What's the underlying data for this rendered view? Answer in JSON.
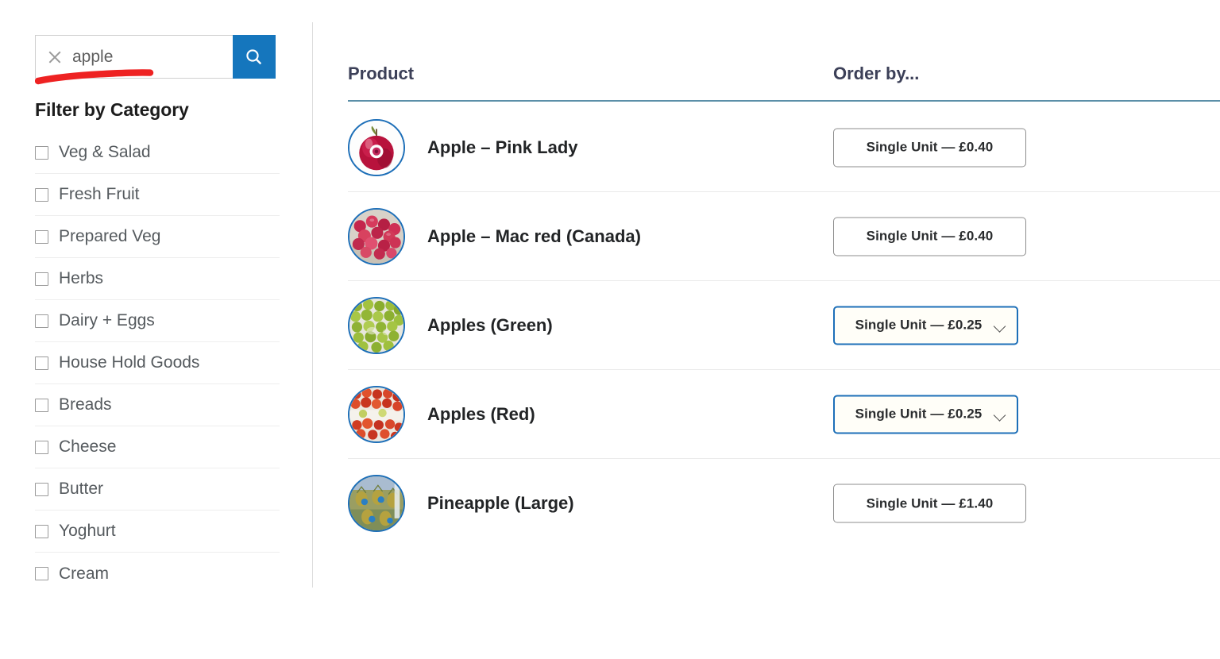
{
  "sidebar": {
    "search": {
      "value": "apple",
      "placeholder": "Search products",
      "clear_icon": "close-icon",
      "search_icon": "search-icon"
    },
    "annotation": {
      "type": "hand-drawn-underline",
      "color": "#ee2222"
    },
    "filter_heading": "Filter by Category",
    "categories": [
      {
        "label": "Veg & Salad",
        "checked": false
      },
      {
        "label": "Fresh Fruit",
        "checked": false
      },
      {
        "label": "Prepared Veg",
        "checked": false
      },
      {
        "label": "Herbs",
        "checked": false
      },
      {
        "label": "Dairy + Eggs",
        "checked": false
      },
      {
        "label": "House Hold Goods",
        "checked": false
      },
      {
        "label": "Breads",
        "checked": false
      },
      {
        "label": "Cheese",
        "checked": false
      },
      {
        "label": "Butter",
        "checked": false
      },
      {
        "label": "Yoghurt",
        "checked": false
      },
      {
        "label": "Cream",
        "checked": false
      }
    ]
  },
  "main": {
    "columns": {
      "product": "Product",
      "order_by": "Order by..."
    },
    "rows": [
      {
        "name": "Apple – Pink Lady",
        "order_label": "Single Unit — £0.40",
        "control": "static",
        "thumb": "single-red-apple"
      },
      {
        "name": "Apple – Mac red (Canada)",
        "order_label": "Single Unit — £0.40",
        "control": "static",
        "thumb": "red-apples-bin"
      },
      {
        "name": "Apples (Green)",
        "order_label": "Single Unit — £0.25",
        "control": "select",
        "thumb": "green-apples-pile"
      },
      {
        "name": "Apples (Red)",
        "order_label": "Single Unit — £0.25",
        "control": "select",
        "thumb": "red-apples-pile"
      },
      {
        "name": "Pineapple (Large)",
        "order_label": "Single Unit — £1.40",
        "control": "static",
        "thumb": "pineapple-crate"
      }
    ]
  },
  "colors": {
    "accent_blue": "#1576bd",
    "select_border": "#1d6fb8",
    "header_rule": "#5b8fa8",
    "annotation_red": "#ee2222"
  }
}
